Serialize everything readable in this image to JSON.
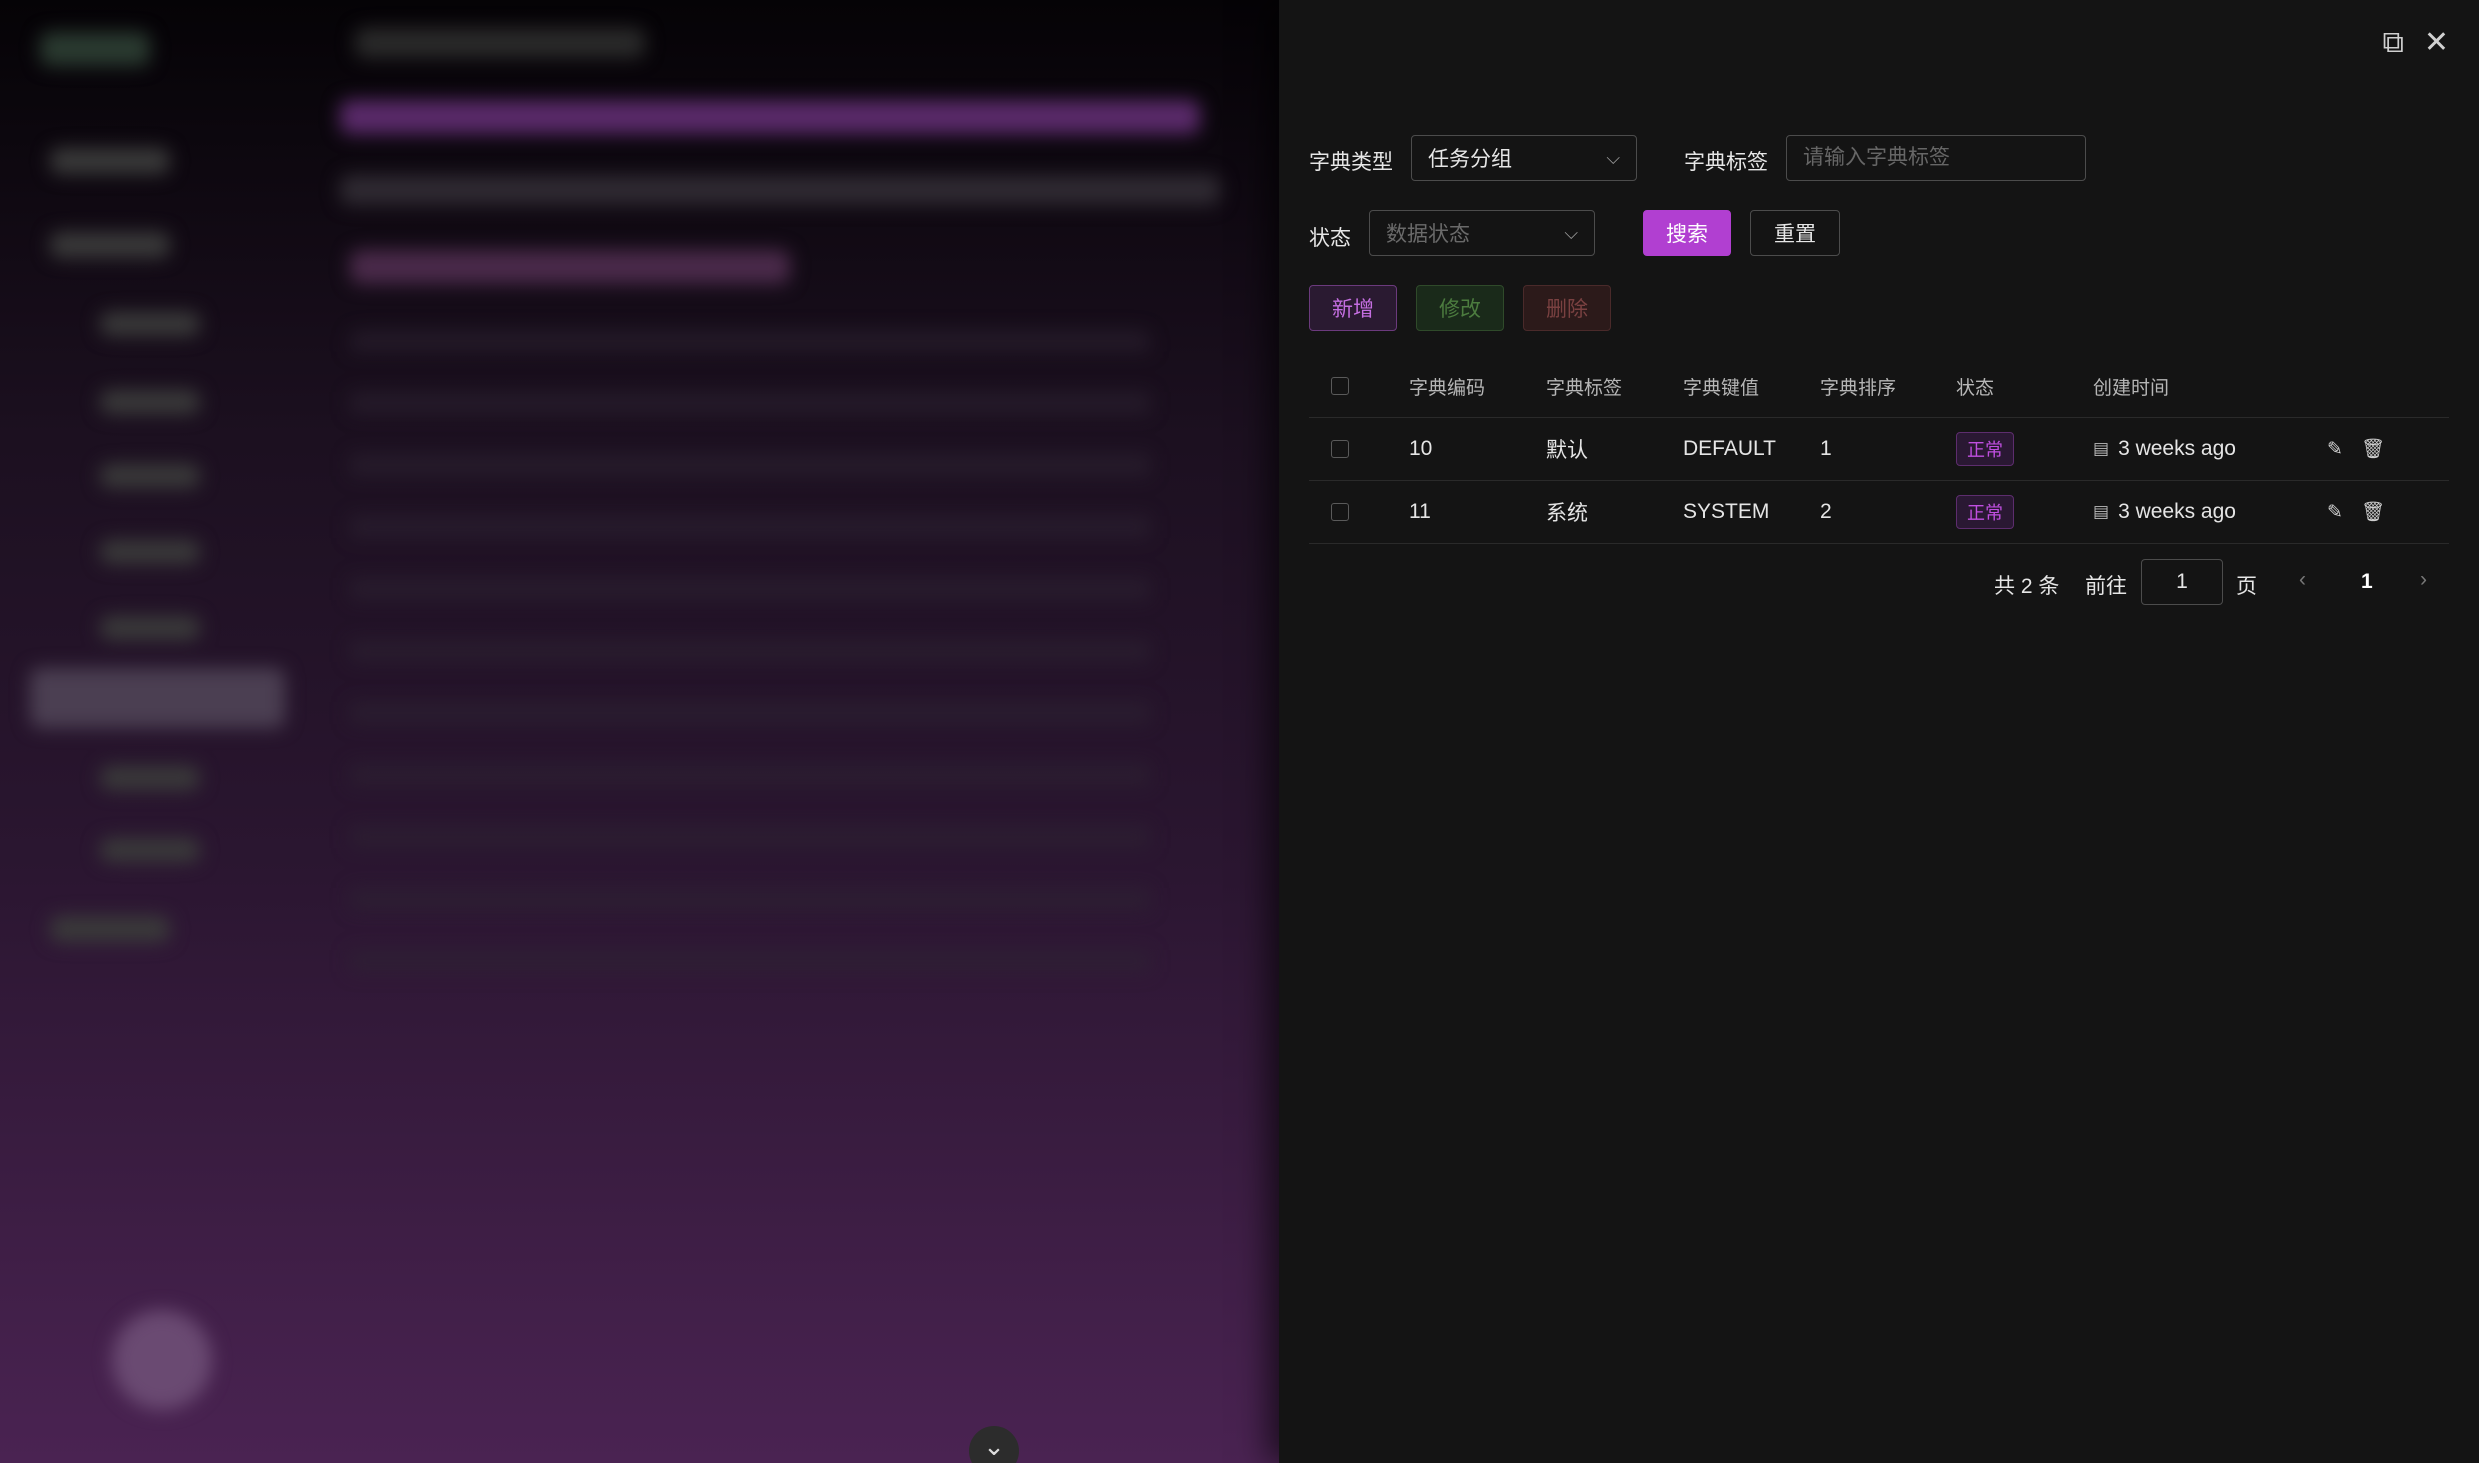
{
  "drawer": {
    "header": {
      "fullscreen_icon": "fullscreen-icon",
      "close_icon": "close-icon"
    },
    "filters": {
      "dict_type_label": "字典类型",
      "dict_type_value": "任务分组",
      "dict_label_label": "字典标签",
      "dict_label_placeholder": "请输入字典标签",
      "status_label": "状态",
      "status_placeholder": "数据状态",
      "search_button": "搜索",
      "reset_button": "重置"
    },
    "toolbar": {
      "add": "新增",
      "edit": "修改",
      "delete": "删除"
    },
    "table": {
      "columns": [
        "字典编码",
        "字典标签",
        "字典键值",
        "字典排序",
        "状态",
        "创建时间"
      ],
      "rows": [
        {
          "code": "10",
          "label": "默认",
          "value": "DEFAULT",
          "sort": "1",
          "status": "正常",
          "created": "3 weeks ago"
        },
        {
          "code": "11",
          "label": "系统",
          "value": "SYSTEM",
          "sort": "2",
          "status": "正常",
          "created": "3 weeks ago"
        }
      ]
    },
    "pagination": {
      "total": "共 2 条",
      "goto_label": "前往",
      "goto_value": "1",
      "page_suffix": "页",
      "current_page": "1",
      "prev_icon": "chevron-left-icon",
      "next_icon": "chevron-right-icon"
    }
  },
  "background": {
    "collapse_icon": "chevron-down-icon"
  }
}
